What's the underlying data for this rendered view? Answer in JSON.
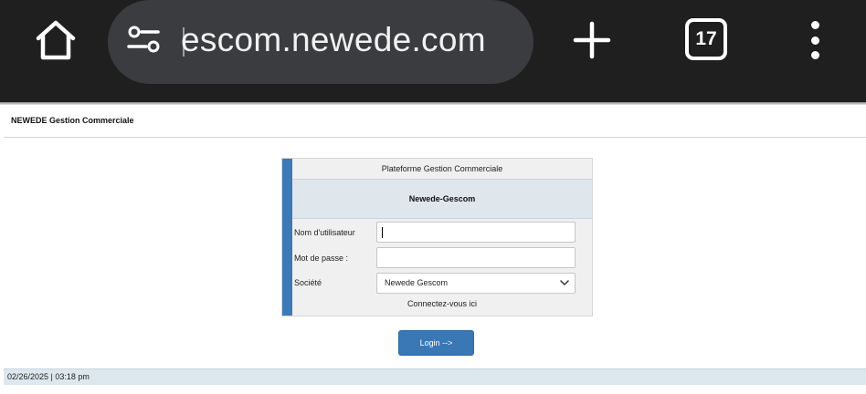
{
  "browser": {
    "url": "escom.newede.com",
    "tab_count": "17",
    "icons": {
      "home": "home-icon",
      "site_settings": "tune-icon",
      "new_tab": "plus-icon",
      "tabs": "tab-switcher-icon",
      "menu": "more-vert-icon"
    }
  },
  "header": {
    "title": "NEWEDE Gestion Commerciale"
  },
  "login": {
    "platform": "Plateforme Gestion Commerciale",
    "brand": "Newede-Gescom",
    "username_label": "Nom d'utilisateur",
    "username_value": "",
    "password_label": "Mot de passe :",
    "password_value": "",
    "company_label": "Société",
    "company_selected": "Newede Gescom",
    "connect_text": "Connectez-vous ici",
    "button_label": "Login -->"
  },
  "footer": {
    "datetime": "02/26/2025 | 03:18 pm"
  },
  "colors": {
    "accent": "#3a78b5",
    "browser_bar": "#1f1f1f",
    "url_pill": "#3a3c3f"
  }
}
